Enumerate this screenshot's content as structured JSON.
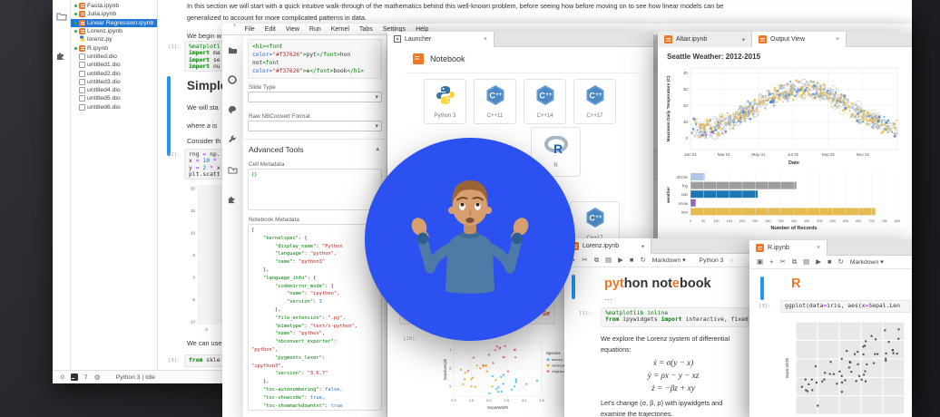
{
  "colors": {
    "jupyter_orange": "#f37626",
    "selection_blue": "#2176d6",
    "circle_blue": "#2b52f0",
    "collapse_bar_blue": "#2196f3"
  },
  "emoji": {
    "name": "man-shrugging"
  },
  "back_window": {
    "activity_icons": [
      "folder-icon",
      "puzzle-icon"
    ],
    "files": [
      {
        "name": "Fasta.ipynb",
        "icon": "notebook",
        "running": true,
        "selected": false
      },
      {
        "name": "Julia.ipynb",
        "icon": "notebook",
        "running": true,
        "selected": false
      },
      {
        "name": "Linear Regression.ipynb",
        "icon": "notebook",
        "running": true,
        "selected": true
      },
      {
        "name": "Lorenz.ipynb",
        "icon": "notebook",
        "running": true,
        "selected": false
      },
      {
        "name": "lorenz.py",
        "icon": "python",
        "running": false,
        "selected": false
      },
      {
        "name": "R.ipynb",
        "icon": "notebook",
        "running": true,
        "selected": false
      },
      {
        "name": "untitled.dio",
        "icon": "file",
        "running": false,
        "selected": false
      },
      {
        "name": "untitled1.dio",
        "icon": "file",
        "running": false,
        "selected": false
      },
      {
        "name": "untitled2.dio",
        "icon": "file",
        "running": false,
        "selected": false
      },
      {
        "name": "untitled3.dio",
        "icon": "file",
        "running": false,
        "selected": false
      },
      {
        "name": "untitled4.dio",
        "icon": "file",
        "running": false,
        "selected": false
      },
      {
        "name": "untitled5.dio",
        "icon": "file",
        "running": false,
        "selected": false
      },
      {
        "name": "untitled6.dio",
        "icon": "file",
        "running": false,
        "selected": false
      }
    ],
    "intro_line1": "In this section we will start with a quick intuitive walk-through of the mathematics behind this well-known problem, before seeing how before moving on to see how linear models can be",
    "intro_line2": "generalized to account for more complicated patterns in data.",
    "we_begin": "We begin w",
    "prompt1": "[1]:",
    "prompt2": "[2]:",
    "prompt3": "[3]:",
    "cell1": [
      [
        [
          "%matplotl",
          "mg"
        ]
      ],
      [
        [
          "import",
          "kw"
        ],
        [
          " ma",
          "pl"
        ]
      ],
      [
        [
          "import",
          "kw"
        ],
        [
          " se",
          "pl"
        ]
      ],
      [
        [
          "import",
          "kw"
        ],
        [
          " nu",
          "pl"
        ]
      ]
    ],
    "heading": "Simple",
    "para1": "We will sta",
    "para2": [
      [
        "where ",
        "d"
      ],
      [
        "a",
        "i"
      ],
      [
        " is",
        "d"
      ]
    ],
    "para3": "Consider th",
    "cell2": [
      [
        [
          "rng ",
          "pl"
        ],
        [
          "=",
          "op"
        ],
        [
          " np.",
          "pl"
        ]
      ],
      [
        [
          "x ",
          "pl"
        ],
        [
          "=",
          "op"
        ],
        [
          " ",
          "pl"
        ],
        [
          "10",
          "num"
        ],
        [
          " ",
          "pl"
        ],
        [
          "*",
          "op"
        ]
      ],
      [
        [
          "y ",
          "pl"
        ],
        [
          "=",
          "op"
        ],
        [
          " ",
          "pl"
        ],
        [
          "2",
          "num"
        ],
        [
          " ",
          "pl"
        ],
        [
          "*",
          "op"
        ],
        [
          " x",
          "pl"
        ]
      ],
      [
        [
          "plt.scatt",
          "pl"
        ]
      ]
    ],
    "para4": "We can use",
    "cell3": [
      [
        [
          "from",
          "kw"
        ],
        [
          " skle",
          "pl"
        ]
      ]
    ],
    "statusbar": {
      "count_a": "0",
      "count_b": "7",
      "kernel_status": "Python 3 | Idle"
    }
  },
  "menu_window": {
    "menus": [
      "File",
      "Edit",
      "View",
      "Run",
      "Kernel",
      "Tabs",
      "Settings",
      "Help"
    ],
    "sidebar_icons": [
      "folder-icon",
      "record-circle-icon",
      "palette-icon",
      "wrench-icon",
      "new-folder-icon",
      "puzzle-icon"
    ],
    "inspector": {
      "html_snippet": [
        [
          [
            "<h1><font",
            "tag"
          ]
        ],
        [
          [
            "color=",
            "attr"
          ],
          [
            "\"#f37626\"",
            "str"
          ],
          [
            ">",
            "tag"
          ],
          [
            "pyt",
            "pl"
          ],
          [
            "</font>",
            "tag"
          ],
          [
            "hon",
            "pl"
          ]
        ],
        [
          [
            "not",
            "pl"
          ],
          [
            "<font",
            "tag"
          ]
        ],
        [
          [
            "color=",
            "attr"
          ],
          [
            "\"#f37626\"",
            "str"
          ],
          [
            ">",
            "tag"
          ],
          [
            "e",
            "pl"
          ],
          [
            "</font>",
            "tag"
          ],
          [
            "book",
            "pl"
          ],
          [
            "</h1>",
            "tag"
          ]
        ]
      ],
      "slide_type_label": "Slide Type",
      "raw_label": "Raw NBConvert Format",
      "advanced_label": "Advanced Tools",
      "advanced_collapse": "▴",
      "cell_meta_label": "Cell Metadata",
      "cell_meta_value": "{}",
      "nb_meta_label": "Notebook Metadata",
      "nb_meta_lines": [
        "{",
        "    \"kernelspec\": {",
        "        \"display_name\": \"Python",
        "        \"language\": \"python\",",
        "        \"name\": \"python3\"",
        "    },",
        "    \"language_info\": {",
        "        \"codemirror_mode\": {",
        "            \"name\": \"ipython\",",
        "            \"version\": 3",
        "        },",
        "        \"file_extension\": \".py\",",
        "        \"mimetype\": \"text/x-python\",",
        "        \"name\": \"python\",",
        "        \"nbconvert_exporter\":",
        "\"python\",",
        "        \"pygments_lexer\":",
        "\"ipython3\",",
        "        \"version\": \"3.6.7\"",
        "    },",
        "    \"toc-autonumbering\": false,",
        "    \"toc-showcode\": true,",
        "    \"toc-showmarkdowntxt\": true",
        "}"
      ]
    }
  },
  "launcher": {
    "tab_label": "Launcher",
    "tab_close": "×",
    "section_label": "Notebook",
    "cards": [
      {
        "label": "Python 3",
        "logo": "python"
      },
      {
        "label": "C++11",
        "logo": "cpp"
      },
      {
        "label": "C++14",
        "logo": "cpp"
      },
      {
        "label": "C++17",
        "logo": "cpp"
      }
    ],
    "extra_cards": [
      {
        "label": "R",
        "logo": "r"
      },
      {
        "label": "C++17",
        "logo": "cpp"
      }
    ],
    "iris": {
      "prompt": "[10]:",
      "error_fragment": "Se"
    }
  },
  "altair": {
    "tabs": [
      {
        "label": "Altair.ipynb",
        "glyph": "●"
      },
      {
        "label": "Output View",
        "glyph": "×"
      }
    ]
  },
  "lorenz": {
    "tab_label": "Lorenz.ipynb",
    "tab_glyph": "●",
    "toolbar_mode": "Markdown",
    "toolbar_kernel": "Python 3",
    "heading": [
      [
        "pyt",
        "o"
      ],
      [
        "hon not",
        "d"
      ],
      [
        "e",
        "o"
      ],
      [
        "book",
        "d"
      ]
    ],
    "dots": "⋯",
    "prompt": "[1]:",
    "code": [
      [
        [
          "%matplotlib inline",
          "mg"
        ]
      ],
      [
        [
          "from",
          "kw"
        ],
        [
          " ipywidgets ",
          "pl"
        ],
        [
          "import",
          "kw"
        ],
        [
          " interactive, fixed",
          "pl"
        ]
      ]
    ],
    "para1a": "We explore the Lorenz system of differential",
    "para1b": "equations:",
    "equations": [
      "ẋ = σ(y − x)",
      "ẏ = ρx − y − xz",
      "ż = −βz + xy"
    ],
    "para2a": "Let's change (σ, β, ρ) with ipywidgets and",
    "para2b": "examine the trajectories."
  },
  "r_window": {
    "tab_label": "R.ipynb",
    "tab_close": "×",
    "toolbar_mode": "Markdown",
    "heading": "R",
    "prompt": "[3]:",
    "code": [
      [
        [
          "ggplot(data",
          "pl"
        ],
        [
          "=",
          "op"
        ],
        [
          "iris, aes(x",
          "pl"
        ],
        [
          "=",
          "op"
        ],
        [
          "Sepal.Len",
          "pl"
        ]
      ]
    ]
  },
  "chart_data": [
    {
      "id": "seattle_scatter",
      "type": "scatter",
      "title": "Seattle Weather: 2012-2015",
      "xlabel": "Date",
      "ylabel": "Maximum Daily Temperature (C)",
      "x_ticks": [
        "Jan 01",
        "Mar 01",
        "May 01",
        "Jul 01",
        "Sep 01",
        "Nov 01"
      ],
      "x_tick_days": [
        0,
        59,
        120,
        181,
        243,
        304
      ],
      "y_ticks": [
        40,
        30,
        20,
        10,
        0
      ],
      "ylim": [
        -7,
        43
      ],
      "series": [
        {
          "name": "sun",
          "color": "#e7ba52"
        },
        {
          "name": "fog",
          "color": "#b0b0b0"
        },
        {
          "name": "rain",
          "color": "#3f83bf"
        },
        {
          "name": "drizzle",
          "color": "#aec7e8"
        },
        {
          "name": "snow",
          "color": "#9467bd"
        }
      ],
      "shape_note": "daily max temps, summer peak ~35C, winter ~8C, point size = precipitation"
    },
    {
      "id": "weather_bars",
      "type": "bar",
      "categories": [
        "drizzle",
        "fog",
        "rain",
        "snow",
        "sun"
      ],
      "values": [
        55,
        410,
        260,
        20,
        715
      ],
      "colors": [
        "#aec7e8",
        "#9e9e9e",
        "#1f77b4",
        "#9467bd",
        "#e7ba52"
      ],
      "xlabel": "Number of Records",
      "ylabel": "weather",
      "x_ticks": [
        0,
        50,
        100,
        150,
        200,
        250,
        300,
        350,
        400,
        450,
        500,
        550,
        600,
        650,
        700,
        750,
        800
      ],
      "xlim": [
        0,
        800
      ]
    },
    {
      "id": "iris_scatter",
      "type": "scatter",
      "xlabel": "SepalWidth",
      "ylabel": "SepalLength",
      "x_ticks": [
        "2.0",
        "2.5",
        "3.0",
        "3.5",
        "4.0",
        "4.5"
      ],
      "y_ticks": [
        "7",
        "6",
        "5"
      ],
      "legend_title": "Species",
      "series": [
        {
          "name": "setosa",
          "color": "#4fc3f7"
        },
        {
          "name": "versicolor",
          "color": "#f2b134"
        },
        {
          "name": "virginica",
          "color": "#f2719e"
        }
      ]
    },
    {
      "id": "ggplot_iris",
      "type": "scatter",
      "ylabel": "Sepal.Width",
      "point_color": "#3c3c3c",
      "panel_bg": "#e8e8e8"
    },
    {
      "id": "regression_preview",
      "type": "scatter",
      "y_ticks": [
        20,
        15,
        10,
        5,
        0,
        -5,
        -10
      ],
      "x_ticks": [
        -2
      ]
    }
  ]
}
